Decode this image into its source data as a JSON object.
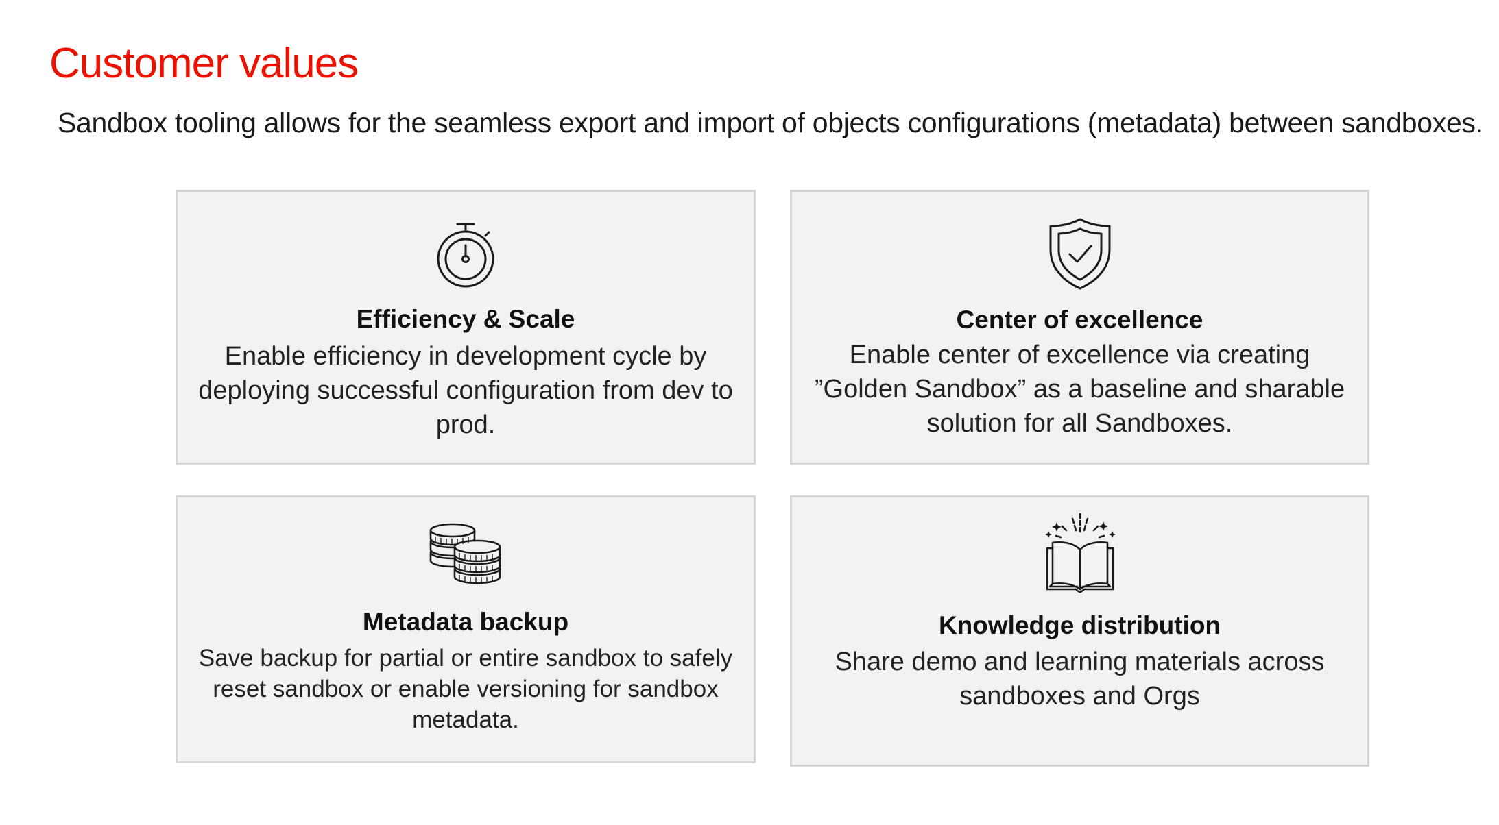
{
  "header": {
    "title": "Customer values",
    "subtitle": "Sandbox tooling allows for the seamless export and import of objects configurations (metadata) between sandboxes."
  },
  "colors": {
    "accent": "#eb1000",
    "card_background": "#f2f2f2",
    "card_border": "#d6d6d6"
  },
  "cards": [
    {
      "icon": "stopwatch-icon",
      "title": "Efficiency & Scale",
      "description": "Enable efficiency in development cycle by deploying successful configuration  from dev to prod."
    },
    {
      "icon": "shield-check-icon",
      "title": "Center of excellence",
      "description": "Enable center of excellence via creating  ”Golden Sandbox” as a baseline and sharable solution for all Sandboxes."
    },
    {
      "icon": "coins-icon",
      "title": "Metadata backup",
      "description": "Save backup for partial or entire sandbox to safely reset sandbox or enable versioning for sandbox metadata."
    },
    {
      "icon": "open-book-sparkle-icon",
      "title": "Knowledge distribution",
      "description": "Share demo and learning materials across sandboxes and Orgs"
    }
  ]
}
